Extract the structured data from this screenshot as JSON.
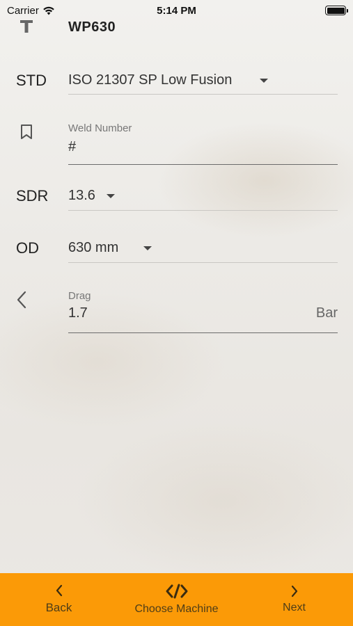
{
  "status_bar": {
    "carrier": "Carrier",
    "time": "5:14 PM"
  },
  "header": {
    "title": "WP630"
  },
  "form": {
    "std": {
      "label": "STD",
      "value": "ISO 21307 SP Low Fusion"
    },
    "weld_number": {
      "caption": "Weld Number",
      "value": "#"
    },
    "sdr": {
      "label": "SDR",
      "value": "13.6"
    },
    "od": {
      "label": "OD",
      "value": "630 mm"
    },
    "drag": {
      "caption": "Drag",
      "value": "1.7",
      "unit": "Bar"
    }
  },
  "bottom_nav": {
    "back_label": "Back",
    "choose_machine_label": "Choose Machine",
    "next_label": "Next"
  },
  "colors": {
    "bottom_bar": "#fb9a07"
  }
}
